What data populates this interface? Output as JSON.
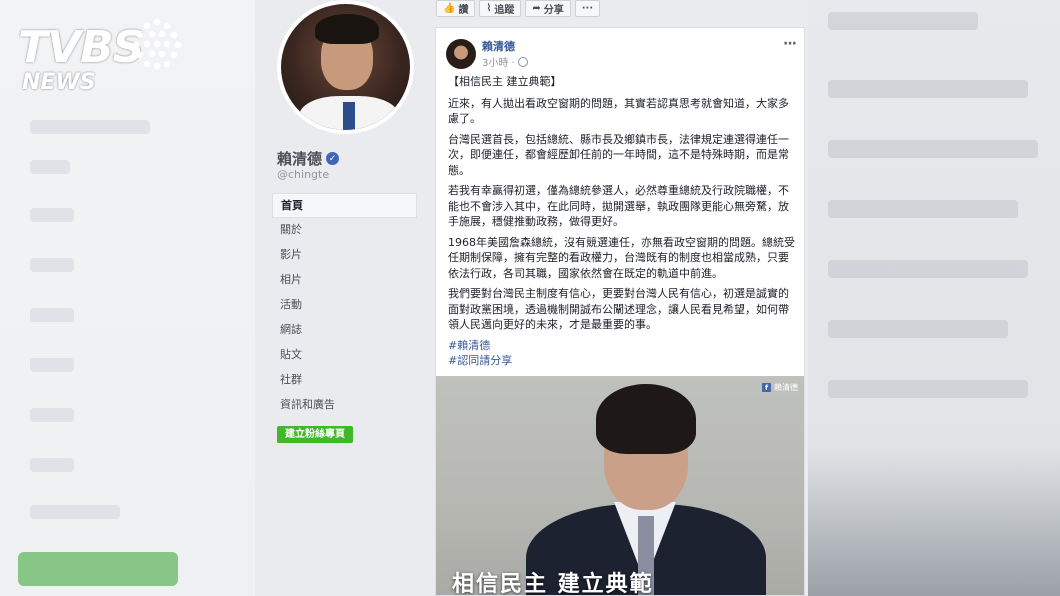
{
  "logo": {
    "main": "TVBS",
    "sub": "NEWS"
  },
  "action_bar": {
    "like": "讚",
    "follow": "追蹤",
    "share": "分享",
    "more": "···"
  },
  "page": {
    "name": "賴清德",
    "handle": "@chingte",
    "nav": [
      "首頁",
      "關於",
      "影片",
      "相片",
      "活動",
      "網誌",
      "貼文",
      "社群",
      "資訊和廣告"
    ],
    "create_button": "建立粉絲專頁"
  },
  "post": {
    "author": "賴清德",
    "time": "3小時 ·",
    "more": "···",
    "title": "【相信民主 建立典範】",
    "paragraphs": [
      "近來，有人拋出看政空窗期的問題，其實若認真思考就會知道，大家多慮了。",
      "台灣民選首長，包括總統、縣市長及鄉鎮市長，法律規定連選得連任一次，即便連任，都會經歷卸任前的一年時間，這不是特殊時期，而是常態。",
      "若我有幸贏得初選，僅為總統參選人，必然尊重總統及行政院職權，不能也不會涉入其中，在此同時，拋開選舉，執政團隊更能心無旁騖，放手施展，穩健推動政務，做得更好。",
      "1968年美國詹森總統，沒有競選連任，亦無看政空窗期的問題。總統受任期制保障，擁有完整的看政權力，台灣既有的制度也相當成熟，只要依法行政，各司其職，國家依然會在既定的軌道中前進。",
      "我們要對台灣民主制度有信心，更要對台灣人民有信心，初選是誠實的面對政黨困境，透過機制開誠布公闡述理念，讓人民看見希望，如何帶領人民邁向更好的未來，才是最重要的事。"
    ],
    "hashtags": [
      "#賴清德",
      "#認同請分享"
    ],
    "image_badge": "賴清德",
    "image_caption": "相信民主 建立典範"
  },
  "colors": {
    "link": "#365899",
    "green_button": "#42b72a",
    "brand_blue": "#4267b2"
  }
}
